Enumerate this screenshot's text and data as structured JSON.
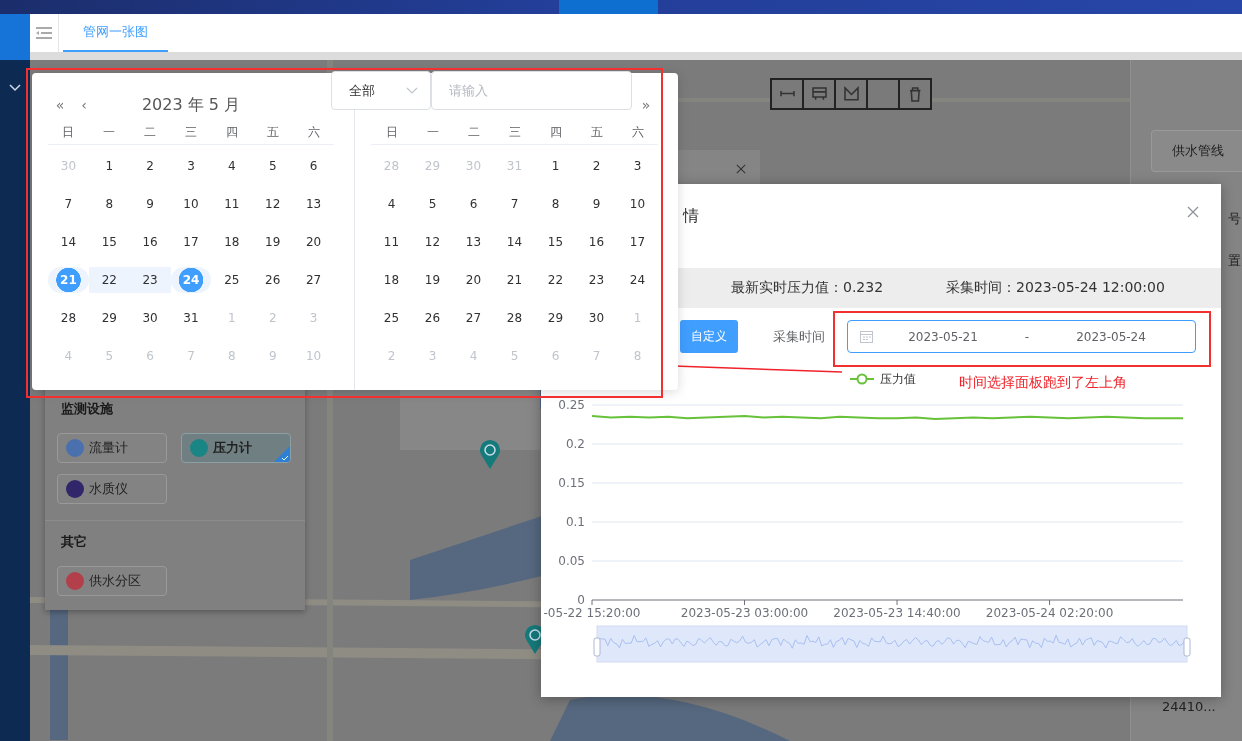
{
  "top_tab": {
    "label": "管网一张图",
    "selected": true
  },
  "facility_panel": {
    "sections": [
      {
        "title": "监测设施",
        "items": [
          {
            "label": "流量计",
            "color": "#4a70ad",
            "selected": false
          },
          {
            "label": "压力计",
            "color": "#1a8585",
            "selected": true
          },
          {
            "label": "水质仪",
            "color": "#32266b",
            "selected": false
          }
        ]
      },
      {
        "title": "其它",
        "items": [
          {
            "label": "供水分区",
            "color": "#b23f4a",
            "selected": false
          }
        ]
      }
    ]
  },
  "right_panel": {
    "button": "供水管线",
    "labels": [
      "号",
      "置"
    ],
    "footer": "24410..."
  },
  "search": {
    "filter": "全部",
    "placeholder": "请输入"
  },
  "date_picker": {
    "nav": {
      "prev_year": "«",
      "prev_month": "‹",
      "next_year": "»"
    },
    "months": [
      {
        "title": "2023 年 5 月",
        "weekdays": [
          "日",
          "一",
          "二",
          "三",
          "四",
          "五",
          "六"
        ],
        "days": [
          {
            "label": "30",
            "muted": true,
            "selected": false,
            "in_range": false
          },
          {
            "label": "1",
            "muted": false,
            "selected": false,
            "in_range": false
          },
          {
            "label": "2",
            "muted": false,
            "selected": false,
            "in_range": false
          },
          {
            "label": "3",
            "muted": false,
            "selected": false,
            "in_range": false
          },
          {
            "label": "4",
            "muted": false,
            "selected": false,
            "in_range": false
          },
          {
            "label": "5",
            "muted": false,
            "selected": false,
            "in_range": false
          },
          {
            "label": "6",
            "muted": false,
            "selected": false,
            "in_range": false
          },
          {
            "label": "7",
            "muted": false,
            "selected": false,
            "in_range": false
          },
          {
            "label": "8",
            "muted": false,
            "selected": false,
            "in_range": false
          },
          {
            "label": "9",
            "muted": false,
            "selected": false,
            "in_range": false
          },
          {
            "label": "10",
            "muted": false,
            "selected": false,
            "in_range": false
          },
          {
            "label": "11",
            "muted": false,
            "selected": false,
            "in_range": false
          },
          {
            "label": "12",
            "muted": false,
            "selected": false,
            "in_range": false
          },
          {
            "label": "13",
            "muted": false,
            "selected": false,
            "in_range": false
          },
          {
            "label": "14",
            "muted": false,
            "selected": false,
            "in_range": false
          },
          {
            "label": "15",
            "muted": false,
            "selected": false,
            "in_range": false
          },
          {
            "label": "16",
            "muted": false,
            "selected": false,
            "in_range": false
          },
          {
            "label": "17",
            "muted": false,
            "selected": false,
            "in_range": false
          },
          {
            "label": "18",
            "muted": false,
            "selected": false,
            "in_range": false
          },
          {
            "label": "19",
            "muted": false,
            "selected": false,
            "in_range": false
          },
          {
            "label": "20",
            "muted": false,
            "selected": false,
            "in_range": false
          },
          {
            "label": "21",
            "muted": false,
            "selected": true,
            "in_range": true
          },
          {
            "label": "22",
            "muted": false,
            "selected": false,
            "in_range": true
          },
          {
            "label": "23",
            "muted": false,
            "selected": false,
            "in_range": true
          },
          {
            "label": "24",
            "muted": false,
            "selected": true,
            "in_range": true
          },
          {
            "label": "25",
            "muted": false,
            "selected": false,
            "in_range": false
          },
          {
            "label": "26",
            "muted": false,
            "selected": false,
            "in_range": false
          },
          {
            "label": "27",
            "muted": false,
            "selected": false,
            "in_range": false
          },
          {
            "label": "28",
            "muted": false,
            "selected": false,
            "in_range": false
          },
          {
            "label": "29",
            "muted": false,
            "selected": false,
            "in_range": false
          },
          {
            "label": "30",
            "muted": false,
            "selected": false,
            "in_range": false
          },
          {
            "label": "31",
            "muted": false,
            "selected": false,
            "in_range": false
          },
          {
            "label": "1",
            "muted": true,
            "selected": false,
            "in_range": false
          },
          {
            "label": "2",
            "muted": true,
            "selected": false,
            "in_range": false
          },
          {
            "label": "3",
            "muted": true,
            "selected": false,
            "in_range": false
          },
          {
            "label": "4",
            "muted": true,
            "selected": false,
            "in_range": false
          },
          {
            "label": "5",
            "muted": true,
            "selected": false,
            "in_range": false
          },
          {
            "label": "6",
            "muted": true,
            "selected": false,
            "in_range": false
          },
          {
            "label": "7",
            "muted": true,
            "selected": false,
            "in_range": false
          },
          {
            "label": "8",
            "muted": true,
            "selected": false,
            "in_range": false
          },
          {
            "label": "9",
            "muted": true,
            "selected": false,
            "in_range": false
          },
          {
            "label": "10",
            "muted": true,
            "selected": false,
            "in_range": false
          }
        ]
      },
      {
        "weekdays": [
          "日",
          "一",
          "二",
          "三",
          "四",
          "五",
          "六"
        ],
        "days": [
          {
            "label": "28",
            "muted": true,
            "selected": false,
            "in_range": false
          },
          {
            "label": "29",
            "muted": true,
            "selected": false,
            "in_range": false
          },
          {
            "label": "30",
            "muted": true,
            "selected": false,
            "in_range": false
          },
          {
            "label": "31",
            "muted": true,
            "selected": false,
            "in_range": false
          },
          {
            "label": "1",
            "muted": false,
            "selected": false,
            "in_range": false
          },
          {
            "label": "2",
            "muted": false,
            "selected": false,
            "in_range": false
          },
          {
            "label": "3",
            "muted": false,
            "selected": false,
            "in_range": false
          },
          {
            "label": "4",
            "muted": false,
            "selected": false,
            "in_range": false
          },
          {
            "label": "5",
            "muted": false,
            "selected": false,
            "in_range": false
          },
          {
            "label": "6",
            "muted": false,
            "selected": false,
            "in_range": false
          },
          {
            "label": "7",
            "muted": false,
            "selected": false,
            "in_range": false
          },
          {
            "label": "8",
            "muted": false,
            "selected": false,
            "in_range": false
          },
          {
            "label": "9",
            "muted": false,
            "selected": false,
            "in_range": false
          },
          {
            "label": "10",
            "muted": false,
            "selected": false,
            "in_range": false
          },
          {
            "label": "11",
            "muted": false,
            "selected": false,
            "in_range": false
          },
          {
            "label": "12",
            "muted": false,
            "selected": false,
            "in_range": false
          },
          {
            "label": "13",
            "muted": false,
            "selected": false,
            "in_range": false
          },
          {
            "label": "14",
            "muted": false,
            "selected": false,
            "in_range": false
          },
          {
            "label": "15",
            "muted": false,
            "selected": false,
            "in_range": false
          },
          {
            "label": "16",
            "muted": false,
            "selected": false,
            "in_range": false
          },
          {
            "label": "17",
            "muted": false,
            "selected": false,
            "in_range": false
          },
          {
            "label": "18",
            "muted": false,
            "selected": false,
            "in_range": false
          },
          {
            "label": "19",
            "muted": false,
            "selected": false,
            "in_range": false
          },
          {
            "label": "20",
            "muted": false,
            "selected": false,
            "in_range": false
          },
          {
            "label": "21",
            "muted": false,
            "selected": false,
            "in_range": false
          },
          {
            "label": "22",
            "muted": false,
            "selected": false,
            "in_range": false
          },
          {
            "label": "23",
            "muted": false,
            "selected": false,
            "in_range": false
          },
          {
            "label": "24",
            "muted": false,
            "selected": false,
            "in_range": false
          },
          {
            "label": "25",
            "muted": false,
            "selected": false,
            "in_range": false
          },
          {
            "label": "26",
            "muted": false,
            "selected": false,
            "in_range": false
          },
          {
            "label": "27",
            "muted": false,
            "selected": false,
            "in_range": false
          },
          {
            "label": "28",
            "muted": false,
            "selected": false,
            "in_range": false
          },
          {
            "label": "29",
            "muted": false,
            "selected": false,
            "in_range": false
          },
          {
            "label": "30",
            "muted": false,
            "selected": false,
            "in_range": false
          },
          {
            "label": "1",
            "muted": true,
            "selected": false,
            "in_range": false
          },
          {
            "label": "2",
            "muted": true,
            "selected": false,
            "in_range": false
          },
          {
            "label": "3",
            "muted": true,
            "selected": false,
            "in_range": false
          },
          {
            "label": "4",
            "muted": true,
            "selected": false,
            "in_range": false
          },
          {
            "label": "5",
            "muted": true,
            "selected": false,
            "in_range": false
          },
          {
            "label": "6",
            "muted": true,
            "selected": false,
            "in_range": false
          },
          {
            "label": "7",
            "muted": true,
            "selected": false,
            "in_range": false
          },
          {
            "label": "8",
            "muted": true,
            "selected": false,
            "in_range": false
          }
        ]
      }
    ]
  },
  "dialog": {
    "title": "情",
    "info": [
      "最新实时压力值：0.232",
      "采集时间：2023-05-24 12:00:00"
    ],
    "custom_button": {
      "label": "自定义",
      "selected": true
    },
    "range_label": "采集时间",
    "range": {
      "start": "2023-05-21",
      "separator": "-",
      "end": "2023-05-24"
    },
    "chart_data": {
      "type": "line",
      "categories": [
        "-05-22 15:20:00",
        null,
        null,
        null,
        null,
        null,
        null,
        null,
        "2023-05-23 03:00:00",
        null,
        null,
        null,
        null,
        null,
        null,
        null,
        "2023-05-23 14:40:00",
        null,
        null,
        null,
        null,
        null,
        null,
        null,
        "2023-05-24 02:20:00",
        null,
        null,
        null,
        null,
        null,
        null,
        null
      ],
      "series": [
        {
          "name": "压力值",
          "color": "#67c23a",
          "values": [
            0.236,
            0.234,
            0.235,
            0.234,
            0.235,
            0.233,
            0.234,
            0.235,
            0.236,
            0.234,
            0.235,
            0.234,
            0.233,
            0.235,
            0.234,
            0.233,
            0.233,
            0.234,
            0.232,
            0.233,
            0.234,
            0.233,
            0.234,
            0.235,
            0.234,
            0.233,
            0.234,
            0.235,
            0.234,
            0.233,
            0.233,
            0.233
          ]
        }
      ],
      "ylim": [
        0,
        0.25
      ],
      "yticks": [
        0,
        0.05,
        0.1,
        0.15,
        0.2,
        0.25
      ],
      "grid": true
    }
  },
  "annotation": {
    "text": "时间选择面板跑到了左上角"
  }
}
